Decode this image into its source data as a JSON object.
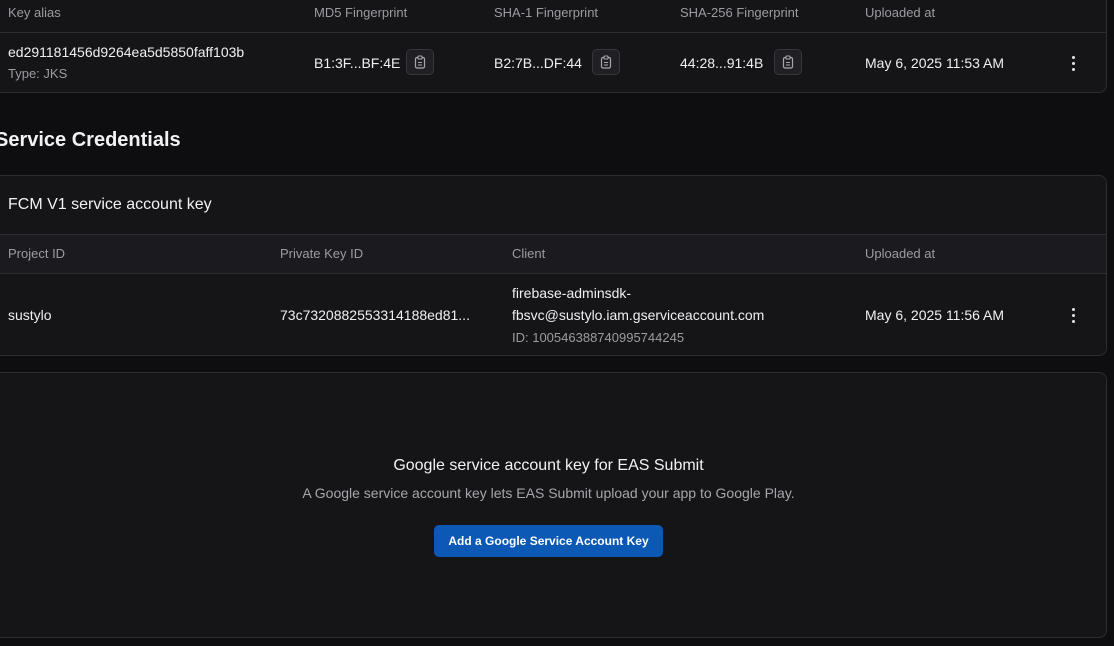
{
  "keystore": {
    "headers": {
      "alias": "Key alias",
      "md5": "MD5 Fingerprint",
      "sha1": "SHA-1 Fingerprint",
      "sha256": "SHA-256 Fingerprint",
      "uploaded": "Uploaded at"
    },
    "row": {
      "alias": "ed291181456d9264ea5d5850faff103b",
      "type": "Type: JKS",
      "md5": "B1:3F...BF:4E",
      "sha1": "B2:7B...DF:44",
      "sha256": "44:28...91:4B",
      "uploaded": "May 6, 2025 11:53 AM"
    }
  },
  "service_credentials": {
    "title": "Service Credentials",
    "fcm": {
      "title": "FCM V1 service account key",
      "headers": {
        "project": "Project ID",
        "private_key": "Private Key ID",
        "client": "Client",
        "uploaded": "Uploaded at"
      },
      "row": {
        "project": "sustylo",
        "private_key": "73c7320882553314188ed81...",
        "client_line1": "firebase-adminsdk-",
        "client_line2": "fbsvc@sustylo.iam.gserviceaccount.com",
        "client_id": "ID: 100546388740995744245",
        "uploaded": "May 6, 2025 11:56 AM"
      }
    },
    "google": {
      "title": "Google service account key for EAS Submit",
      "description": "A Google service account key lets EAS Submit upload your app to Google Play.",
      "button": "Add a Google Service Account Key"
    }
  },
  "icons": {
    "copy": "clipboard-icon",
    "menu": "more-vertical-icon"
  }
}
